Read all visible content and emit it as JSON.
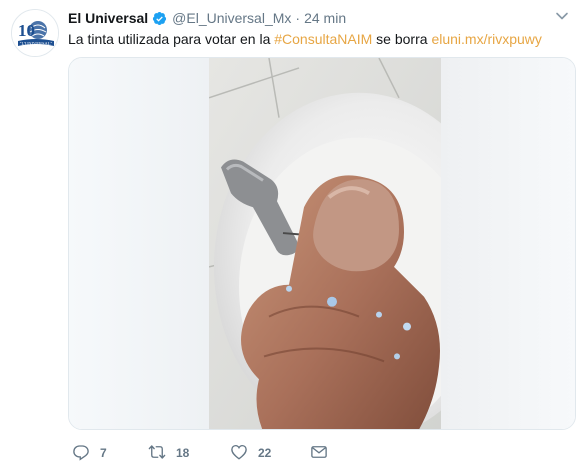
{
  "tweet": {
    "author_name": "El Universal",
    "author_handle": "@El_Universal_Mx",
    "separator": "·",
    "time": "24 min",
    "text_before": "La tinta utilizada para votar en la ",
    "hashtag": "#ConsultaNAIM",
    "text_middle": " se borra ",
    "link": "eluni.mx/rivxpuwy",
    "avatar_text": "10",
    "avatar_ribbon": "\"L'UNIVERSAL\"",
    "link_color": "#e7a644",
    "verified_color": "#1da1f2"
  },
  "actions": {
    "reply_count": "7",
    "retweet_count": "18",
    "like_count": "22"
  },
  "icons": [
    "verified-icon",
    "caret-down-icon",
    "reply-icon",
    "retweet-icon",
    "like-icon",
    "direct-message-icon"
  ]
}
